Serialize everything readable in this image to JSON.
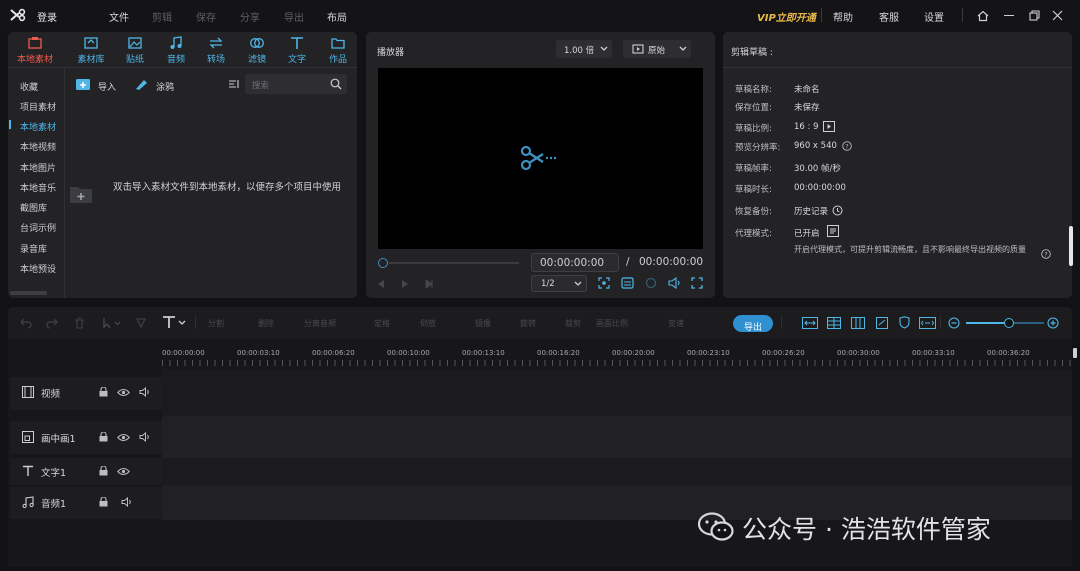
{
  "titlebar": {
    "login": "登录",
    "menus": [
      "文件",
      "剪辑",
      "保存",
      "分享",
      "导出",
      "布局"
    ],
    "vip": "VIP立即开通",
    "help": "帮助",
    "service": "客服",
    "settings": "设置"
  },
  "media": {
    "categories": [
      "本地素材",
      "素材库",
      "贴纸",
      "音频",
      "转场",
      "滤镜",
      "文字",
      "作品"
    ],
    "sidebar": [
      "收藏",
      "项目素材",
      "本地素材",
      "本地视频",
      "本地图片",
      "本地音乐",
      "截图库",
      "台词示例",
      "录音库",
      "本地预设"
    ],
    "import": "导入",
    "graffiti": "涂鸦",
    "search_placeholder": "搜索",
    "empty_hint": "双击导入素材文件到本地素材，以便存多个项目中使用"
  },
  "player": {
    "title": "播放器",
    "speed": "1.00 倍",
    "ratio": "原始",
    "current": "00:00:00:00",
    "sep": "/",
    "total": "00:00:00:00",
    "scale": "1/2"
  },
  "draft": {
    "title": "剪辑草稿 :",
    "name_k": "草稿名称:",
    "name_v": "未命名",
    "path_k": "保存位置:",
    "path_v": "未保存",
    "ratio_k": "草稿比例:",
    "ratio_v": "16 : 9",
    "res_k": "预览分辨率:",
    "res_v": "960 x 540",
    "fps_k": "草稿帧率:",
    "fps_v": "30.00 帧/秒",
    "dur_k": "草稿时长:",
    "dur_v": "00:00:00:00",
    "backup_k": "恢复备份:",
    "backup_v": "历史记录",
    "proxy_k": "代理模式:",
    "proxy_v": "已开启",
    "proxy_desc": "开启代理模式，可提升剪辑流畅度，且不影响最终导出视频的质量"
  },
  "timeline": {
    "export": "导出",
    "tools": [
      "分割",
      "删除",
      "分离音频",
      "定格",
      "倒放",
      "镜像",
      "旋转",
      "裁剪",
      "画面比例",
      "变速"
    ],
    "ticks": [
      "00:00:00:00",
      "00:00:03:10",
      "00:00:06:20",
      "00:00:10:00",
      "00:00:13:10",
      "00:00:16:20",
      "00:00:20:00",
      "00:00:23:10",
      "00:00:26:20",
      "00:00:30:00",
      "00:00:33:10",
      "00:00:36:20"
    ],
    "tracks": [
      "视频",
      "画中画1",
      "文字1",
      "音频1"
    ],
    "zoom": 0.55
  },
  "watermark": "公众号 · 浩浩软件管家",
  "colors": {
    "accent": "#4fb6e6",
    "active_red": "#f05a4f",
    "vip": "#e8b84a"
  }
}
